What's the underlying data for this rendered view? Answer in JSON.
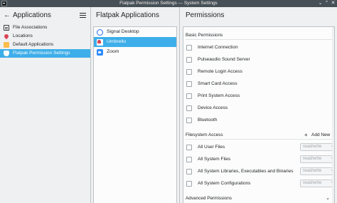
{
  "window": {
    "title": "Flatpak Permission Settings — System Settings",
    "controls": [
      "⌄",
      "⌃",
      "✕"
    ]
  },
  "headers": {
    "applications": "Applications",
    "flatpak_applications": "Flatpak Applications",
    "permissions": "Permissions"
  },
  "sidebar": {
    "items": [
      {
        "label": "File Associations",
        "icon": "file-icon"
      },
      {
        "label": "Locations",
        "icon": "location-pin-icon"
      },
      {
        "label": "Default Applications",
        "icon": "puzzle-icon"
      },
      {
        "label": "Flatpak Permission Settings",
        "icon": "shield-icon",
        "active": true
      }
    ]
  },
  "apps": {
    "items": [
      {
        "label": "Signal Desktop",
        "icon": "signal-icon"
      },
      {
        "label": "Umbrello",
        "icon": "umbrello-icon",
        "active": true
      },
      {
        "label": "Zoom",
        "icon": "zoom-icon"
      }
    ]
  },
  "permissions": {
    "basic": {
      "title": "Basic Permissions",
      "items": [
        "Internet Connection",
        "Pulseaudio Sound Server",
        "Remote Login Access",
        "Smart Card Access",
        "Print System Access",
        "Device Access",
        "Bluetooth"
      ]
    },
    "filesystem": {
      "title": "Filesystem Access",
      "add_new": "Add New",
      "items": [
        {
          "label": "All User Files",
          "mode": "read/write"
        },
        {
          "label": "All System Files",
          "mode": "read/write"
        },
        {
          "label": "All System Libraries, Executables and Binaries",
          "mode": "read/write"
        },
        {
          "label": "All System Configurations",
          "mode": "read/write"
        }
      ]
    },
    "advanced": {
      "title": "Advanced Permissions"
    }
  },
  "colors": {
    "accent": "#3daee9",
    "titlebar": "#475057",
    "background": "#eff0f1"
  }
}
